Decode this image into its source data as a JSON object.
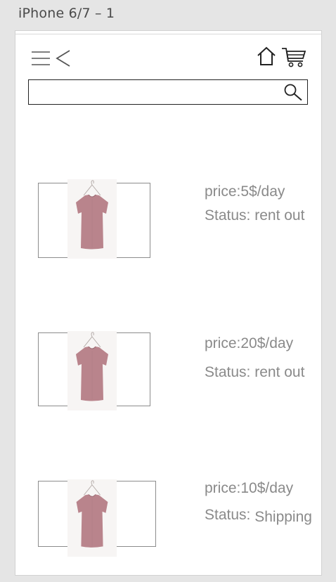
{
  "artboard": {
    "label": "iPhone 6/7 – 1"
  },
  "header": {
    "icons": [
      "menu-icon",
      "back-icon",
      "home-icon",
      "cart-icon"
    ]
  },
  "search": {
    "value": "",
    "placeholder": ""
  },
  "products": [
    {
      "price": "price:5$/day",
      "status_label": "Status:",
      "status_value": "rent out"
    },
    {
      "price": "price:20$/day",
      "status_label": "Status:",
      "status_value": "rent out"
    },
    {
      "price": "price:10$/day",
      "status_label": "Status:",
      "status_value": "Shipping"
    }
  ],
  "colors": {
    "background": "#e5e5e5",
    "screen": "#ffffff",
    "text_muted": "#8a8a8a",
    "shirt": "#b9848c"
  }
}
